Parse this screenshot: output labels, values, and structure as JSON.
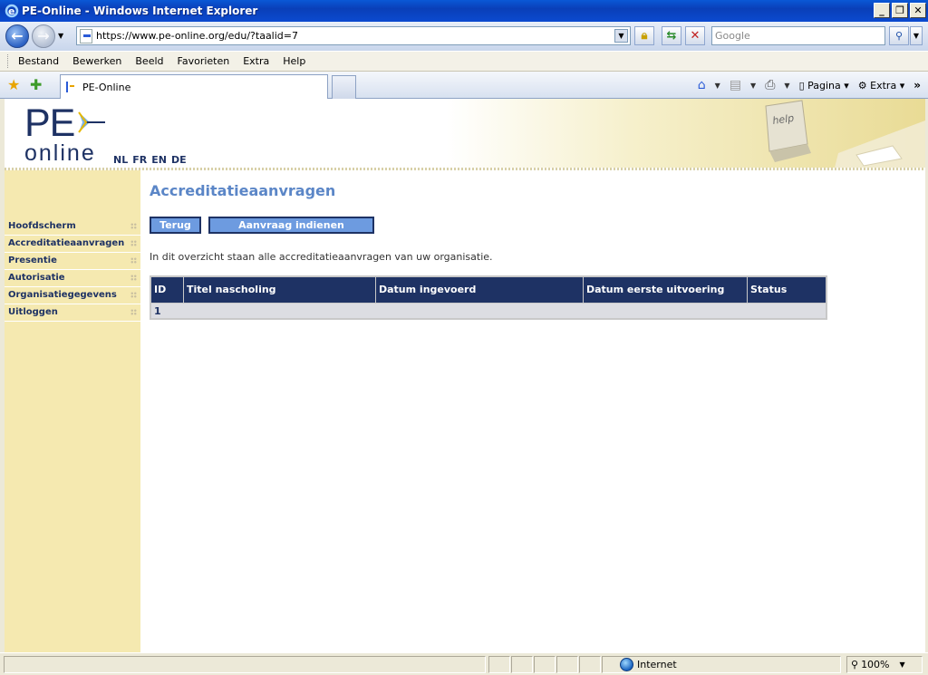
{
  "window": {
    "title": "PE-Online - Windows Internet Explorer"
  },
  "browser": {
    "address": "https://www.pe-online.org/edu/?taalid=7",
    "search_placeholder": "Google",
    "menu": [
      "Bestand",
      "Bewerken",
      "Beeld",
      "Favorieten",
      "Extra",
      "Help"
    ],
    "tab_title": "PE-Online",
    "commands": {
      "page": "Pagina",
      "tools": "Extra"
    },
    "status_zone": "Internet",
    "zoom": "100%"
  },
  "site": {
    "logo_top": "PE",
    "logo_bottom": "online",
    "languages": [
      "NL",
      "FR",
      "EN",
      "DE"
    ],
    "banner_image_text": "help"
  },
  "sidebar": {
    "items": [
      {
        "label": "Hoofdscherm"
      },
      {
        "label": "Accreditatieaanvragen"
      },
      {
        "label": "Presentie"
      },
      {
        "label": "Autorisatie"
      },
      {
        "label": "Organisatiegegevens"
      },
      {
        "label": "Uitloggen"
      }
    ]
  },
  "main": {
    "title": "Accreditatieaanvragen",
    "buttons": {
      "back": "Terug",
      "submit": "Aanvraag indienen"
    },
    "intro": "In dit overzicht staan alle accreditatieaanvragen van uw organisatie.",
    "table": {
      "columns": [
        "ID",
        "Titel nascholing",
        "Datum ingevoerd",
        "Datum eerste uitvoering",
        "Status"
      ],
      "rows": [
        [
          "1",
          "",
          "",
          "",
          ""
        ]
      ]
    }
  },
  "colors": {
    "navy": "#1e3264",
    "accent": "#5b86c7",
    "sidebar": "#f5e9b0",
    "button": "#6d9be0"
  }
}
